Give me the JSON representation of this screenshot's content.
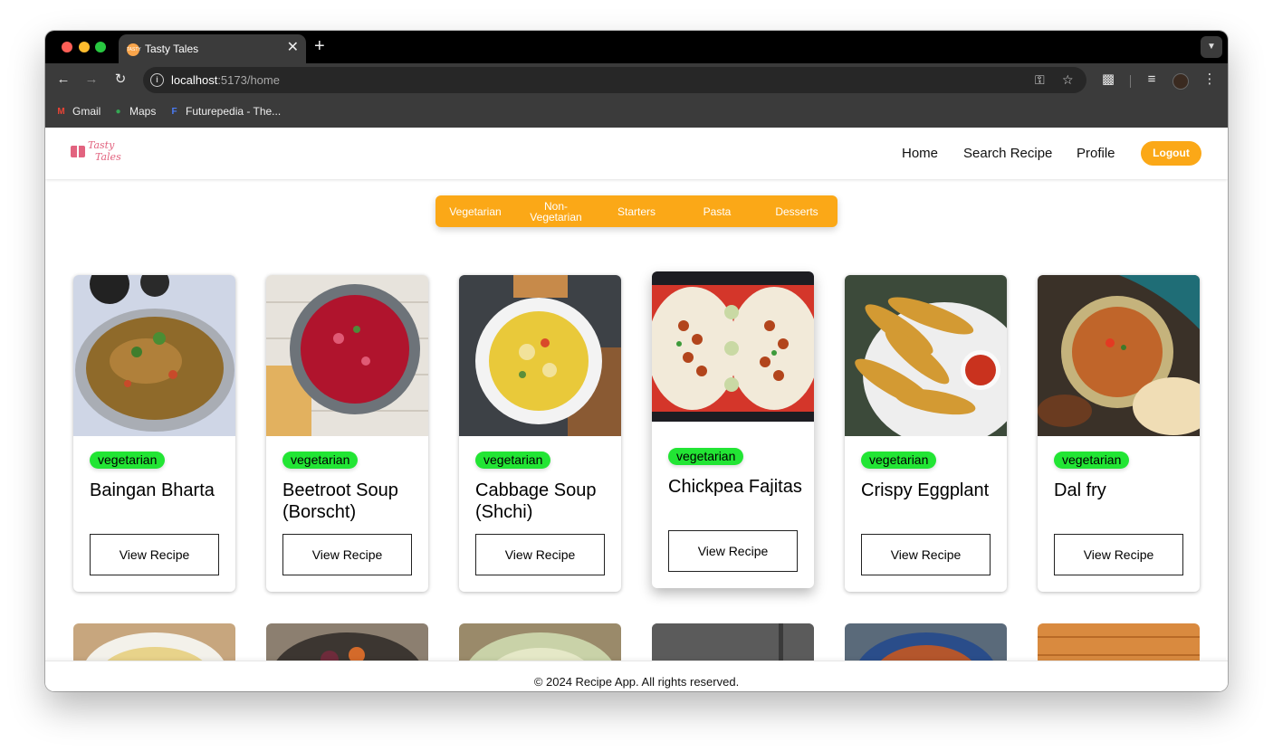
{
  "browser": {
    "tab_title": "Tasty Tales",
    "tab_favicon_text": "TASTY",
    "close_glyph": "✕",
    "newtab_glyph": "+",
    "url_host": "localhost",
    "url_path": ":5173/home",
    "bookmarks": [
      {
        "label": "Gmail",
        "icon": "gmail-icon"
      },
      {
        "label": "Maps",
        "icon": "maps-icon"
      },
      {
        "label": "Futurepedia - The...",
        "icon": "futurepedia-icon"
      }
    ]
  },
  "site": {
    "logo_line1": "Tasty",
    "logo_line2": "Tales",
    "nav": {
      "home": "Home",
      "search": "Search Recipe",
      "profile": "Profile",
      "logout": "Logout"
    },
    "categories": [
      "Vegetarian",
      "Non-\nVegetarian",
      "Starters",
      "Pasta",
      "Desserts"
    ],
    "recipes": [
      {
        "tag": "vegetarian",
        "title": "Baingan Bharta",
        "button": "View Recipe"
      },
      {
        "tag": "vegetarian",
        "title": "Beetroot Soup (Borscht)",
        "button": "View Recipe"
      },
      {
        "tag": "vegetarian",
        "title": "Cabbage Soup (Shchi)",
        "button": "View Recipe"
      },
      {
        "tag": "vegetarian",
        "title": "Chickpea Fajitas",
        "button": "View Recipe"
      },
      {
        "tag": "vegetarian",
        "title": "Crispy Eggplant",
        "button": "View Recipe"
      },
      {
        "tag": "vegetarian",
        "title": "Dal fry",
        "button": "View Recipe"
      }
    ],
    "footer": "© 2024 Recipe App. All rights reserved."
  },
  "colors": {
    "accent": "#fba817",
    "badge": "#22e534",
    "logo": "#e2637f"
  }
}
